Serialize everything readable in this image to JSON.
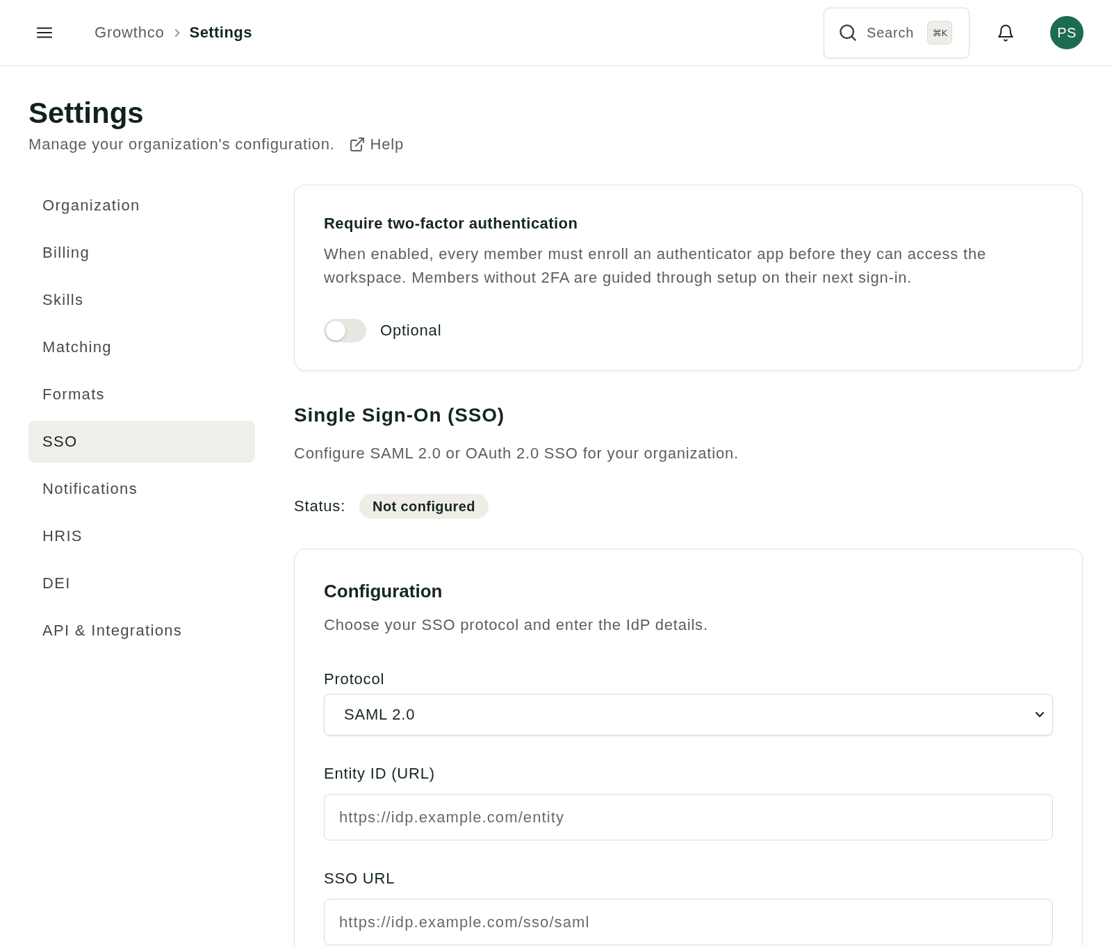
{
  "topbar": {
    "breadcrumb": [
      {
        "label": "Growthco",
        "current": false
      },
      {
        "label": "Settings",
        "current": true
      }
    ],
    "search": {
      "label": "Search",
      "shortcut": "⌘K"
    },
    "avatar": {
      "initials": "PS"
    }
  },
  "page": {
    "title": "Settings",
    "subtitle": "Manage your organization's configuration.",
    "help_link": "Help"
  },
  "sidebar": {
    "items": [
      {
        "label": "Organization",
        "selected": false
      },
      {
        "label": "Billing",
        "selected": false
      },
      {
        "label": "Skills",
        "selected": false
      },
      {
        "label": "Matching",
        "selected": false
      },
      {
        "label": "Formats",
        "selected": false
      },
      {
        "label": "SSO",
        "selected": true
      },
      {
        "label": "Notifications",
        "selected": false
      },
      {
        "label": "HRIS",
        "selected": false
      },
      {
        "label": "DEI",
        "selected": false
      },
      {
        "label": "API & Integrations",
        "selected": false
      }
    ]
  },
  "two_factor": {
    "title": "Require two-factor authentication",
    "description": "When enabled, every member must enroll an authenticator app before they can access the workspace. Members without 2FA are guided through setup on their next sign-in.",
    "toggle": {
      "on": false,
      "label": "Optional"
    }
  },
  "sso": {
    "title": "Single Sign-On (SSO)",
    "description": "Configure SAML 2.0 or OAuth 2.0 SSO for your organization.",
    "status_label": "Status:",
    "status": "Not configured"
  },
  "configuration": {
    "title": "Configuration",
    "description": "Choose your SSO protocol and enter the IdP details.",
    "fields": [
      {
        "kind": "select",
        "label": "Protocol",
        "value": "SAML 2.0"
      },
      {
        "kind": "text",
        "label": "Entity ID (URL)",
        "placeholder": "https://idp.example.com/entity"
      },
      {
        "kind": "text",
        "label": "SSO URL",
        "placeholder": "https://idp.example.com/sso/saml"
      }
    ]
  }
}
